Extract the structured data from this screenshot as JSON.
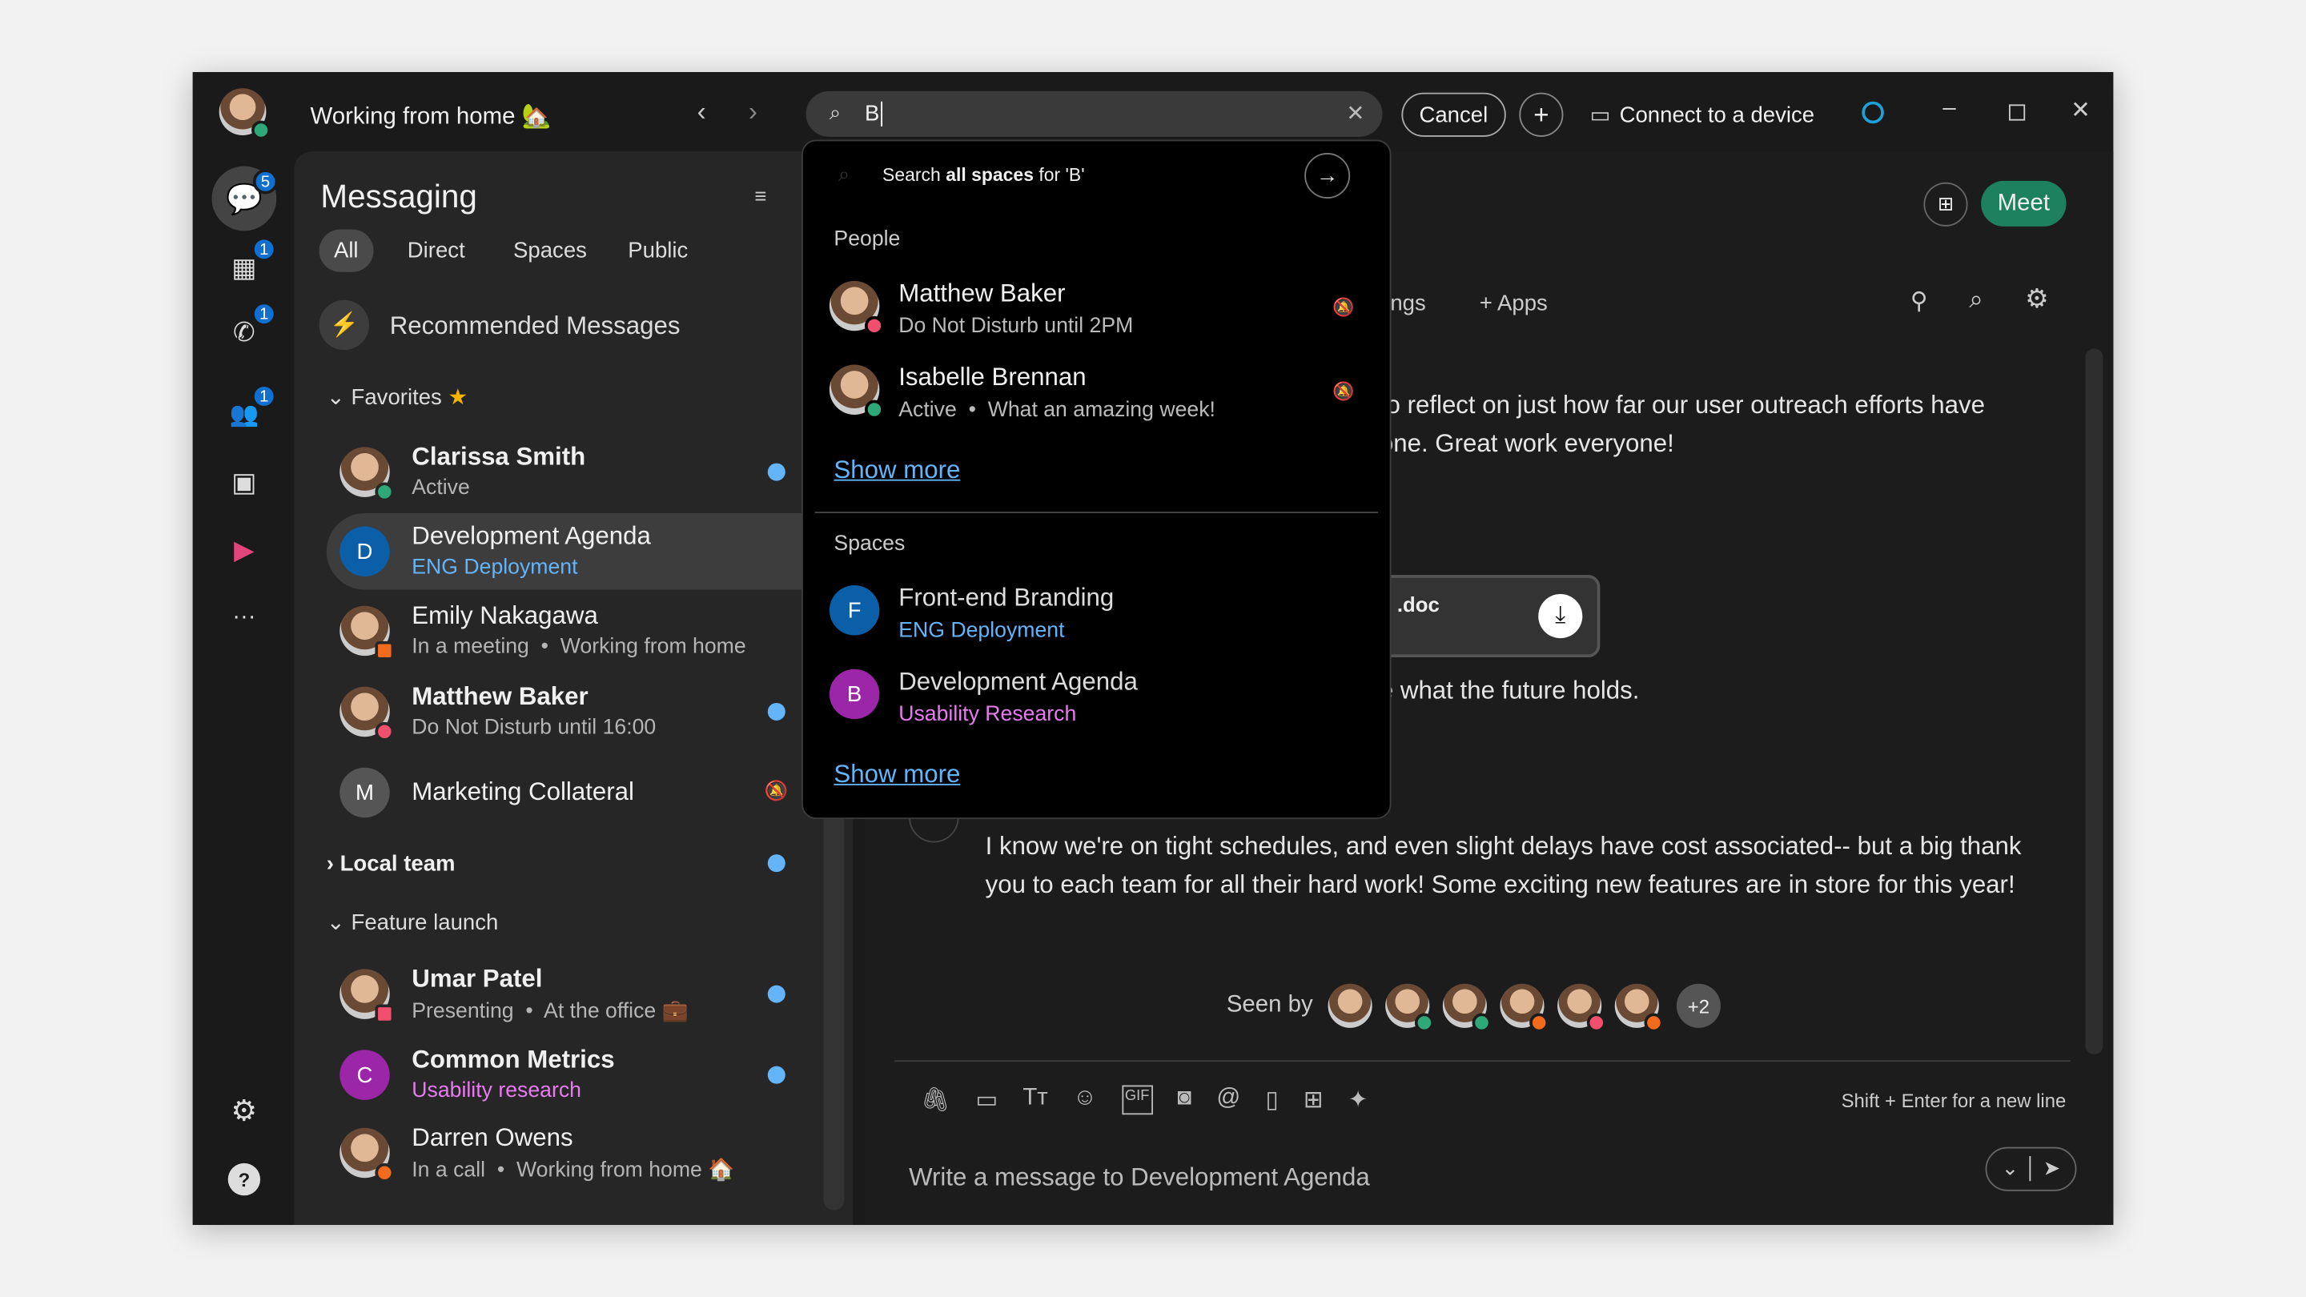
{
  "titlebar": {
    "status": "Working from home 🏡",
    "search_value": "B",
    "cancel": "Cancel",
    "connect": "Connect to a device"
  },
  "rail": {
    "badges": {
      "messaging": "5",
      "calendar": "1",
      "calls": "1",
      "teams": "1"
    }
  },
  "sidebar": {
    "title": "Messaging",
    "tabs": [
      "All",
      "Direct",
      "Spaces",
      "Public"
    ],
    "recommended": "Recommended Messages",
    "favorites": "Favorites",
    "items": [
      {
        "name": "Clarissa Smith",
        "sub": "Active",
        "unread": true,
        "bold": true
      },
      {
        "name": "Development Agenda",
        "sub": "ENG Deployment",
        "initial": "D",
        "selected": true
      },
      {
        "name": "Emily Nakagawa",
        "sub": "In a meeting  •  Working from home"
      },
      {
        "name": "Matthew Baker",
        "sub": "Do Not Disturb until 16:00",
        "unread": true,
        "bold": true
      },
      {
        "name": "Marketing Collateral",
        "initial": "M",
        "muted": true
      }
    ],
    "local_team": "Local team",
    "feature_launch": "Feature launch",
    "items2": [
      {
        "name": "Umar Patel",
        "sub": "Presenting  •  At the office 💼",
        "unread": true
      },
      {
        "name": "Common Metrics",
        "sub": "Usability research",
        "initial": "C",
        "unread": true
      },
      {
        "name": "Darren Owens",
        "sub": "In a call  •  Working from home 🏠"
      }
    ]
  },
  "dropdown": {
    "search_all_pre": "Search ",
    "search_all_bold": "all spaces",
    "search_all_post": " for 'B'",
    "people_label": "People",
    "people": [
      {
        "name": "Matthew Baker",
        "sub": "Do Not Disturb until 2PM"
      },
      {
        "name": "Isabelle Brennan",
        "sub": "Active  •  What an amazing week!"
      }
    ],
    "show_more": "Show more",
    "spaces_label": "Spaces",
    "spaces": [
      {
        "initial": "F",
        "name": "Front-end Branding",
        "sub": "ENG Deployment"
      },
      {
        "initial": "B",
        "name": "Development Agenda",
        "sub": "Usability Research"
      }
    ]
  },
  "main": {
    "meet": "Meet",
    "tab_partial": "ings",
    "apps": "Apps",
    "msg1_l1": "to reflect on just how far our user outreach efforts have",
    "msg1_l2": "one. Great work everyone!",
    "file": ".doc",
    "msg2": "e what the future holds.",
    "msg3_l1": "I know we're on tight schedules, and even slight delays have cost associated-- but a big thank",
    "msg3_l2": "you to each team for all their hard work! Some exciting new features are in store for this year!",
    "seen_by": "Seen by",
    "seen_more": "+2",
    "hint": "Shift + Enter for a new line",
    "composer_placeholder": "Write a message to Development Agenda"
  },
  "colors": {
    "accent": "#64b4fa",
    "meet": "#1d8160",
    "active": "#2ea878",
    "dnd": "#f0506e",
    "busy": "#f26b1d",
    "space_blue": "#0a5fa8",
    "space_purple": "#9b27a8",
    "usability": "#e87bef"
  }
}
